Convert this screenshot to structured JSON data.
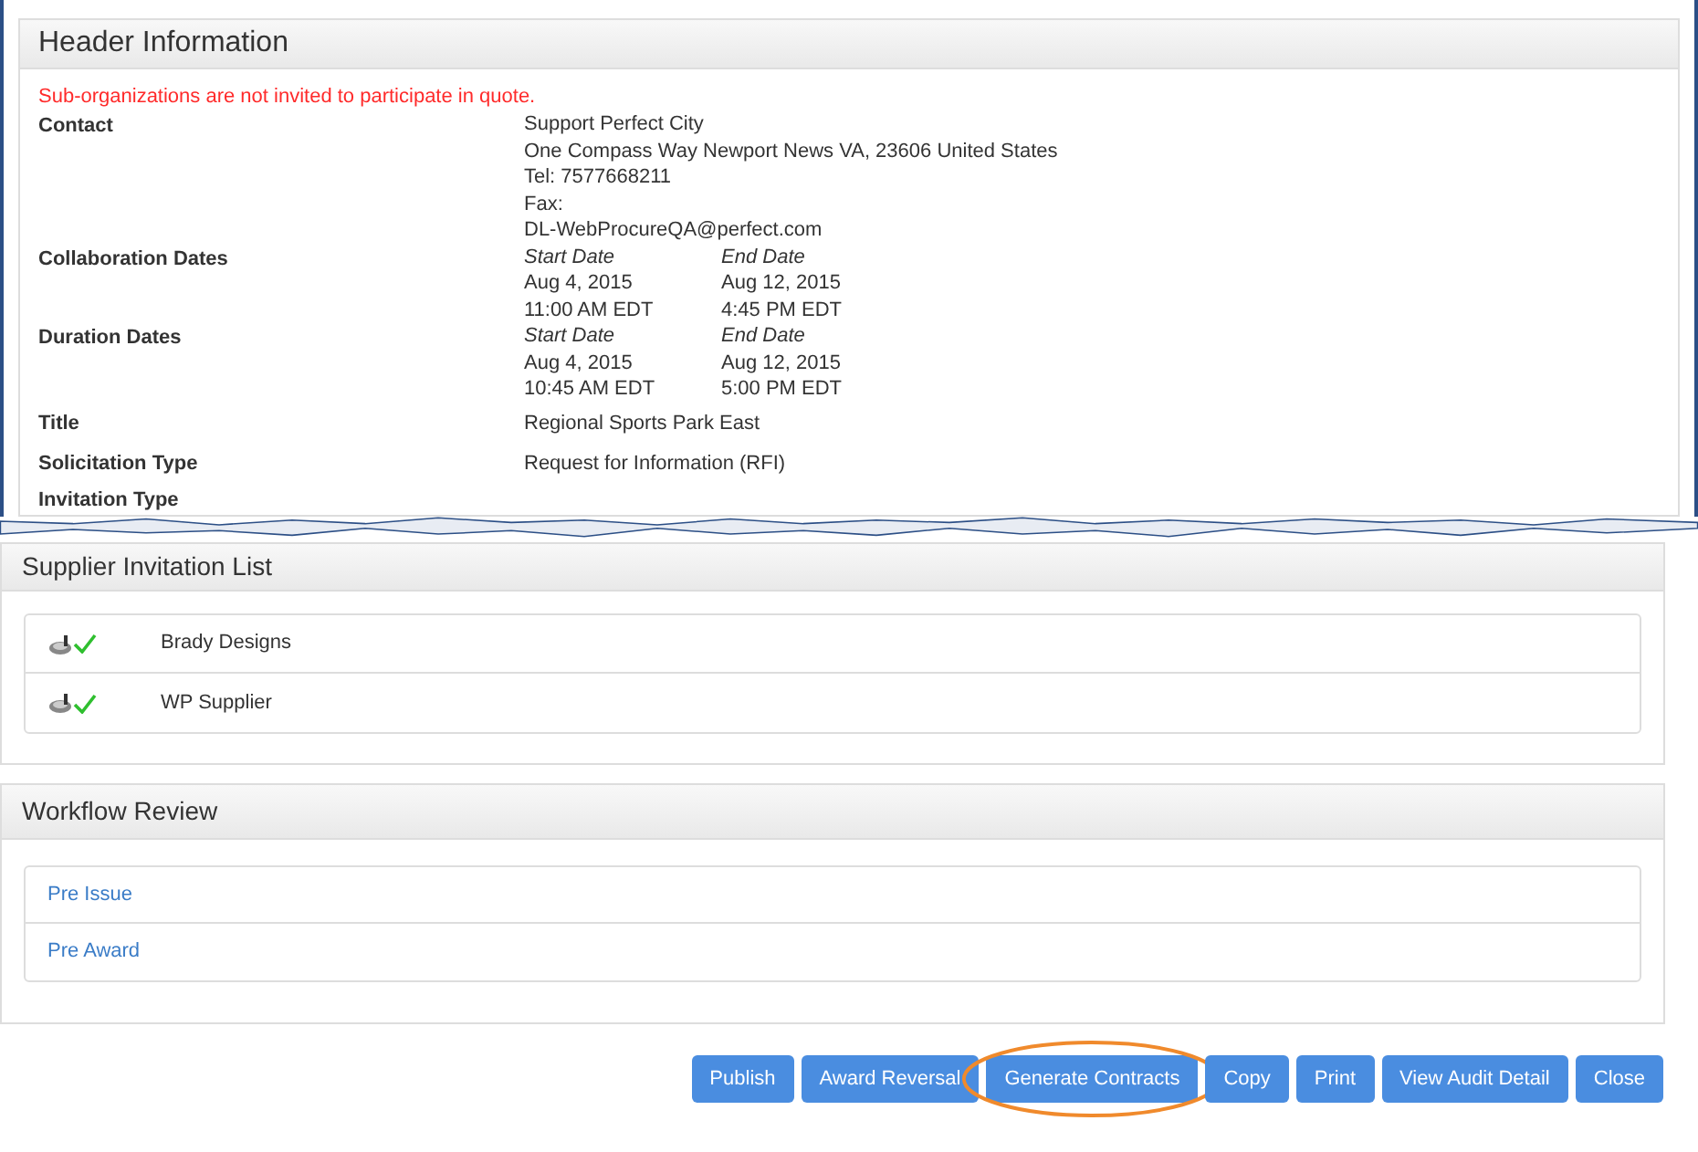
{
  "header": {
    "title": "Header Information",
    "notice": "Sub-organizations are not invited to participate in quote.",
    "fields": [
      {
        "label": "Contact",
        "kind": "lines",
        "lines": [
          "Support Perfect City",
          "One Compass Way Newport News VA, 23606 United States",
          "Tel: 7577668211",
          "Fax:",
          "DL-WebProcureQA@perfect.com"
        ]
      },
      {
        "label": "Collaboration Dates",
        "kind": "dates",
        "columns": [
          {
            "heading": "Start Date",
            "date": "Aug 4, 2015",
            "time": "11:00 AM EDT"
          },
          {
            "heading": "End Date",
            "date": "Aug 12, 2015",
            "time": "4:45 PM EDT"
          }
        ]
      },
      {
        "label": "Duration Dates",
        "kind": "dates",
        "columns": [
          {
            "heading": "Start Date",
            "date": "Aug 4, 2015",
            "time": "10:45 AM EDT"
          },
          {
            "heading": "End Date",
            "date": "Aug 12, 2015",
            "time": "5:00 PM EDT"
          }
        ]
      },
      {
        "label": "Title",
        "kind": "text",
        "value": "Regional Sports Park East"
      },
      {
        "label": "Solicitation Type",
        "kind": "text",
        "value": "Request for Information (RFI)"
      },
      {
        "label": "Invitation Type",
        "kind": "label"
      }
    ]
  },
  "suppliers": {
    "title": "Supplier Invitation List",
    "items": [
      {
        "name": "Brady Designs",
        "accepted": true
      },
      {
        "name": "WP Supplier",
        "accepted": true
      }
    ]
  },
  "workflow": {
    "title": "Workflow Review",
    "items": [
      "Pre Issue",
      "Pre Award"
    ]
  },
  "buttons": [
    {
      "label": "Publish",
      "highlighted": false
    },
    {
      "label": "Award Reversal",
      "highlighted": false
    },
    {
      "label": "Generate Contracts",
      "highlighted": true
    },
    {
      "label": "Copy",
      "highlighted": false
    },
    {
      "label": "Print",
      "highlighted": false
    },
    {
      "label": "View Audit Detail",
      "highlighted": false
    },
    {
      "label": "Close",
      "highlighted": false
    }
  ]
}
